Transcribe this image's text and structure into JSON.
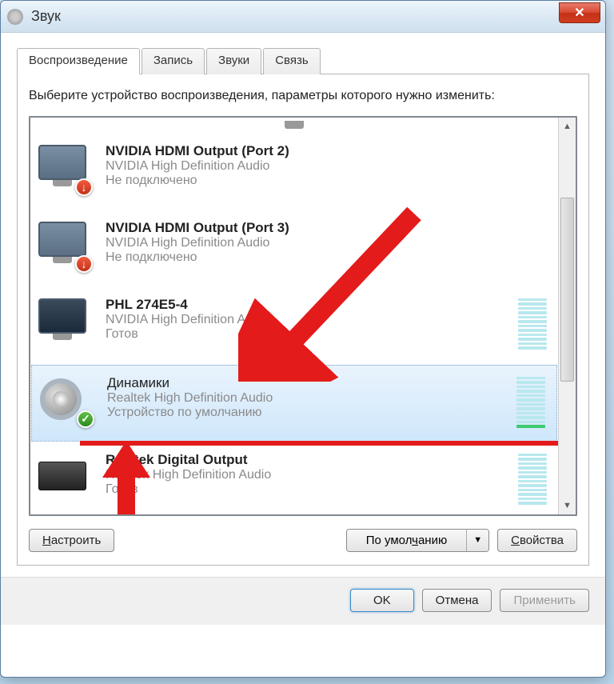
{
  "window": {
    "title": "Звук"
  },
  "tabs": {
    "playback": "Воспроизведение",
    "recording": "Запись",
    "sounds": "Звуки",
    "communications": "Связь"
  },
  "instruction": "Выберите устройство воспроизведения, параметры которого нужно изменить:",
  "devices": [
    {
      "name": "NVIDIA HDMI Output (Port 2)",
      "driver": "NVIDIA High Definition Audio",
      "status": "Не подключено",
      "icon": "monitor-light",
      "badge": "down",
      "meter": null
    },
    {
      "name": "NVIDIA HDMI Output (Port 3)",
      "driver": "NVIDIA High Definition Audio",
      "status": "Не подключено",
      "icon": "monitor-light",
      "badge": "down",
      "meter": null
    },
    {
      "name": "PHL 274E5-4",
      "driver": "NVIDIA High Definition Audio",
      "status": "Готов",
      "icon": "monitor-dark",
      "badge": null,
      "meter": {
        "total": 12,
        "on": 0
      }
    },
    {
      "name": "Динамики",
      "driver": "Realtek High Definition Audio",
      "status": "Устройство по умолчанию",
      "icon": "speaker",
      "badge": "check",
      "meter": {
        "total": 12,
        "on": 1
      },
      "selected": true
    },
    {
      "name": "Realtek Digital Output",
      "driver": "Realtek High Definition Audio",
      "status": "Готов",
      "icon": "receiver",
      "badge": null,
      "meter": {
        "total": 12,
        "on": 0
      }
    }
  ],
  "buttons": {
    "configure": "Настроить",
    "setdefault": "По умолчанию",
    "properties": "Свойства",
    "ok": "OK",
    "cancel": "Отмена",
    "apply": "Применить"
  }
}
